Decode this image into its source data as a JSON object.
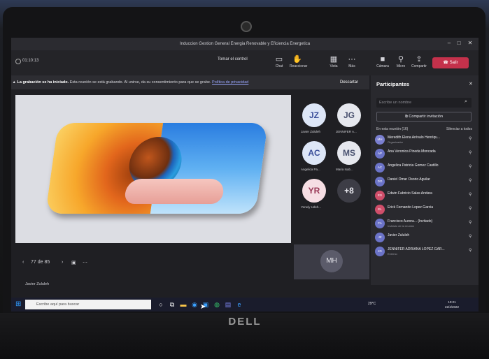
{
  "window": {
    "title": "Induccion Gestion General Energia Renovable y Eficiencia Energetica"
  },
  "toolbar": {
    "timer": "01:10:13",
    "take_control": "Tomar el control",
    "icons": [
      {
        "icon": "chat-icon",
        "label": "Chat"
      },
      {
        "icon": "raise-hand-icon",
        "label": "Reaccionar"
      },
      {
        "icon": "view-icon",
        "label": "Vista"
      },
      {
        "icon": "more-icon",
        "label": "Más"
      }
    ],
    "camera": "Cámara",
    "mic": "Micro",
    "share": "Compartir",
    "leave": "Salir"
  },
  "recording_banner": {
    "bold": "La grabación se ha iniciado.",
    "text": "Esta reunión se está grabando. Al unirse, da su consentimiento para que se grabe.",
    "link": "Política de privacidad",
    "dismiss": "Descartar"
  },
  "slide_nav": {
    "page": "77 de 85",
    "prev": "‹",
    "next": "›"
  },
  "presenter": "Javier Zululeh",
  "gallery": [
    {
      "initials": "JZ",
      "name": "Javier Zululeh",
      "bg": "#dde6f7",
      "fg": "#3b4f9a"
    },
    {
      "initials": "JG",
      "name": "JENNIFER A...",
      "bg": "#e6e8ee",
      "fg": "#4a5270"
    },
    {
      "initials": "AC",
      "name": "Angelica Pa...",
      "bg": "#dde6f7",
      "fg": "#3b4f9a"
    },
    {
      "initials": "MS",
      "name": "Maria Isab...",
      "bg": "#e6e8ee",
      "fg": "#4a5270"
    },
    {
      "initials": "YR",
      "name": "Yenely Udeh...",
      "bg": "#f6dee4",
      "fg": "#9a3b58"
    },
    {
      "initials": "+8",
      "name": "",
      "bg": "#3d3d46",
      "fg": "#e8e8ee"
    }
  ],
  "self_tile": {
    "initials": "MH"
  },
  "participants": {
    "title": "Participantes",
    "search_placeholder": "Escribe un nombre",
    "share_invite": "Compartir invitación",
    "in_meeting": "En esta reunión (16)",
    "mute_all": "Silenciar a todos",
    "people": [
      {
        "name": "Meredith Elena Arévalo Henríqu...",
        "sub": "Organizador",
        "initials": "MH",
        "color": "#7a7fd0"
      },
      {
        "name": "Ana Veronica Pineda Moncada",
        "sub": "",
        "initials": "AP",
        "color": "#6b73c8"
      },
      {
        "name": "Angelica Patricia Gomez Castillo",
        "sub": "",
        "initials": "AC",
        "color": "#6b73c8"
      },
      {
        "name": "Daniel Omar Osorio Aguilar",
        "sub": "",
        "initials": "DO",
        "color": "#6b73c8"
      },
      {
        "name": "Edwin Fabricio Salas Andara",
        "sub": "",
        "initials": "ES",
        "color": "#d04e6a"
      },
      {
        "name": "Erick Fernando Lopez Garcia",
        "sub": "",
        "initials": "EL",
        "color": "#d04e6a"
      },
      {
        "name": "Francisco Aurora... (Invitado)",
        "sub": "Invitado de la reunión",
        "initials": "FA",
        "color": "#6b73c8"
      },
      {
        "name": "Javier Zululeh",
        "sub": "",
        "initials": "JZ",
        "color": "#6b73c8"
      },
      {
        "name": "JENNIFER ADRIANA LOPEZ GAR...",
        "sub": "Externo",
        "initials": "JG",
        "color": "#6b73c8"
      }
    ]
  },
  "taskbar": {
    "search_placeholder": "Escribe aquí para buscar",
    "weather": "29°C",
    "time": "10:21",
    "date": "22/4/2022"
  }
}
